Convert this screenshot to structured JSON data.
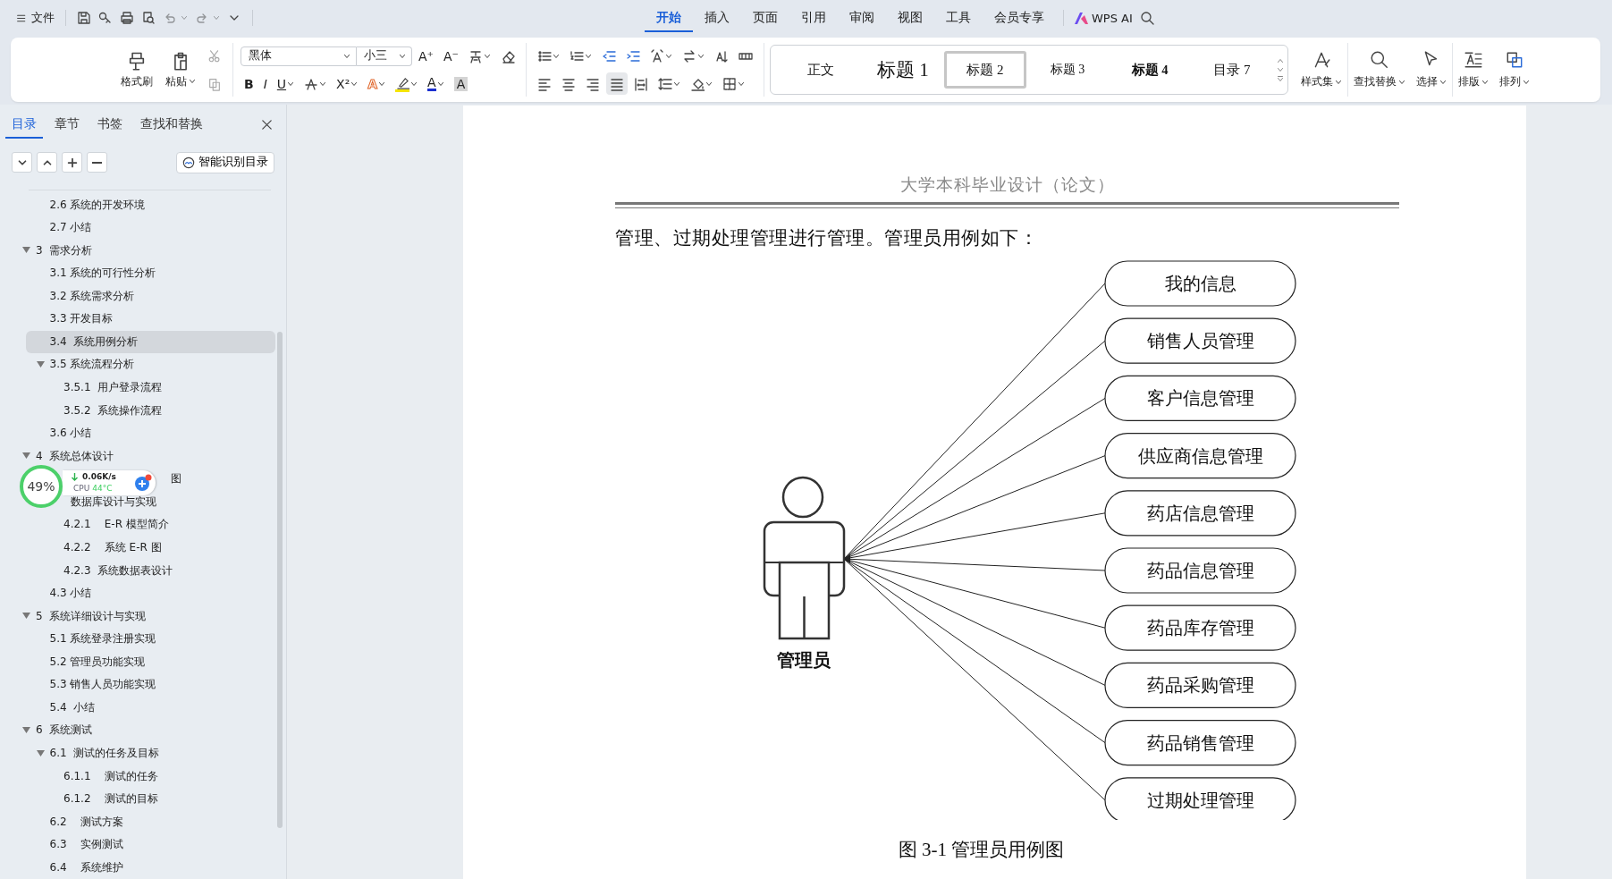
{
  "quick_access": {
    "menu_label": "文件"
  },
  "menu_tabs": [
    {
      "label": "开始",
      "selected": true
    },
    {
      "label": "插入",
      "selected": false
    },
    {
      "label": "页面",
      "selected": false
    },
    {
      "label": "引用",
      "selected": false
    },
    {
      "label": "审阅",
      "selected": false
    },
    {
      "label": "视图",
      "selected": false
    },
    {
      "label": "工具",
      "selected": false
    },
    {
      "label": "会员专享",
      "selected": false
    }
  ],
  "ai_button": "WPS AI",
  "ribbon": {
    "clipboard": [
      {
        "kind": "format-painter",
        "label": "格式刷",
        "dropdown": false
      },
      {
        "kind": "paste",
        "label": "粘贴",
        "dropdown": true
      }
    ],
    "clipboard_small": [
      {
        "kind": "cut",
        "disabled": true
      },
      {
        "kind": "copy",
        "disabled": true
      }
    ],
    "font_name": "黑体",
    "font_size": "小三",
    "font_row1": [
      {
        "kind": "grow",
        "glyph": "A⁺",
        "dropdown": false
      },
      {
        "kind": "shrink",
        "glyph": "A⁻",
        "dropdown": false
      },
      {
        "kind": "phonetic",
        "dropdown": true
      },
      {
        "kind": "eraser",
        "dropdown": false
      }
    ],
    "font_row2": [
      {
        "kind": "bold",
        "glyph": "B",
        "dropdown": false
      },
      {
        "kind": "italic",
        "glyph": "I",
        "dropdown": false
      },
      {
        "kind": "underline",
        "glyph": "U",
        "dropdown": true
      },
      {
        "kind": "strike",
        "dropdown": true
      },
      {
        "kind": "superscript",
        "glyph": "X²",
        "dropdown": true
      },
      {
        "kind": "text-effect",
        "glyph": "A",
        "dropdown": true
      },
      {
        "kind": "highlight",
        "dropdown": true
      },
      {
        "kind": "font-color",
        "glyph": "A",
        "dropdown": true
      },
      {
        "kind": "shading",
        "glyph": "A",
        "dropdown": false
      }
    ],
    "para_row1": [
      {
        "kind": "bullets",
        "dropdown": true
      },
      {
        "kind": "numbering",
        "dropdown": true
      },
      {
        "kind": "outdent",
        "dropdown": false
      },
      {
        "kind": "indent",
        "dropdown": false
      },
      {
        "kind": "text-direction",
        "dropdown": true
      },
      {
        "kind": "swap",
        "dropdown": true
      },
      {
        "kind": "sort",
        "dropdown": false
      },
      {
        "kind": "table-width",
        "dropdown": false
      }
    ],
    "alignment": [
      {
        "kind": "left",
        "selected": false
      },
      {
        "kind": "center",
        "selected": false
      },
      {
        "kind": "right",
        "selected": false
      },
      {
        "kind": "justify",
        "selected": true
      },
      {
        "kind": "distributed",
        "selected": false
      }
    ],
    "para_row2": [
      {
        "kind": "line-spacing",
        "dropdown": true
      },
      {
        "kind": "fill",
        "dropdown": true
      },
      {
        "kind": "border",
        "dropdown": true
      }
    ],
    "styles": [
      {
        "label": "正文",
        "kind": "normal",
        "selected": false
      },
      {
        "label": "标题  1",
        "kind": "h1",
        "selected": false
      },
      {
        "label": "标题  2",
        "kind": "h2",
        "selected": true
      },
      {
        "label": "标题  3",
        "kind": "h3",
        "selected": false
      },
      {
        "label": "标题  4",
        "kind": "h4",
        "selected": false
      },
      {
        "label": "目录  7",
        "kind": "toc",
        "selected": false
      }
    ],
    "tools": [
      {
        "kind": "style-set",
        "label": "样式集"
      },
      {
        "kind": "find",
        "label": "查找替换"
      },
      {
        "kind": "select",
        "label": "选择"
      },
      {
        "kind": "layout",
        "label": "排版"
      },
      {
        "kind": "arrange",
        "label": "排列"
      }
    ]
  },
  "nav_pane": {
    "tabs": [
      {
        "label": "目录",
        "selected": true
      },
      {
        "label": "章节",
        "selected": false
      },
      {
        "label": "书签",
        "selected": false
      },
      {
        "label": "查找和替换",
        "selected": false
      }
    ],
    "smart_toc": "智能识别目录",
    "outline": [
      {
        "children": [
          {
            "label": "2.6 系统的开发环境",
            "selected": false
          },
          {
            "label": "2.7 小结",
            "selected": false
          }
        ]
      },
      {
        "label": "3  需求分析",
        "selected": false,
        "expanded": true,
        "children": [
          {
            "label": "3.1 系统的可行性分析",
            "selected": false
          },
          {
            "label": "3.2 系统需求分析",
            "selected": false
          },
          {
            "label": "3.3 开发目标",
            "selected": false
          },
          {
            "label": "3.4  系统用例分析",
            "selected": true
          },
          {
            "label": "3.5 系统流程分析",
            "selected": false,
            "expanded": true,
            "children": [
              {
                "label": "3.5.1  用户登录流程",
                "selected": false
              },
              {
                "label": "3.5.2  系统操作流程",
                "selected": false
              }
            ]
          },
          {
            "label": "3.6 小结",
            "selected": false
          }
        ]
      },
      {
        "label": "4  系统总体设计",
        "selected": false,
        "expanded": true,
        "children": [
          {
            "label": "图",
            "selected": false,
            "kind": "after-widget"
          },
          {
            "label": "数据库设计与实现",
            "selected": false,
            "kind": "partial",
            "children": [
              {
                "label": "4.2.1    E-R 模型简介",
                "selected": false
              },
              {
                "label": "4.2.2    系统 E-R 图",
                "selected": false
              },
              {
                "label": "4.2.3  系统数据表设计",
                "selected": false
              }
            ]
          },
          {
            "label": "4.3 小结",
            "selected": false
          }
        ]
      },
      {
        "label": "5  系统详细设计与实现",
        "selected": false,
        "expanded": true,
        "children": [
          {
            "label": "5.1 系统登录注册实现",
            "selected": false
          },
          {
            "label": "5.2 管理员功能实现",
            "selected": false
          },
          {
            "label": "5.3 销售人员功能实现",
            "selected": false
          },
          {
            "label": "5.4  小结",
            "selected": false
          }
        ]
      },
      {
        "label": "6  系统测试",
        "selected": false,
        "expanded": true,
        "children": [
          {
            "label": "6.1  测试的任务及目标",
            "selected": false,
            "expanded": true,
            "children": [
              {
                "label": "6.1.1    测试的任务",
                "selected": false
              },
              {
                "label": "6.1.2    测试的目标",
                "selected": false
              }
            ]
          },
          {
            "label": "6.2    测试方案",
            "selected": false
          },
          {
            "label": "6.3    实例测试",
            "selected": false
          },
          {
            "label": "6.4    系统维护",
            "selected": false
          }
        ]
      }
    ]
  },
  "widget": {
    "percent": "49%",
    "net_speed": "0.06K/s",
    "cpu_label": "CPU",
    "cpu_temp": "44°C"
  },
  "document": {
    "header": "大学本科毕业设计（论文）",
    "paragraph": "管理、过期处理管理进行管理。管理员用例如下：",
    "diagram": {
      "actor": "管理员",
      "use_cases": [
        "我的信息",
        "销售人员管理",
        "客户信息管理",
        "供应商信息管理",
        "药店信息管理",
        "药品信息管理",
        "药品库存管理",
        "药品采购管理",
        "药品销售管理",
        "过期处理管理"
      ]
    },
    "caption": "图 3-1  管理员用例图"
  }
}
